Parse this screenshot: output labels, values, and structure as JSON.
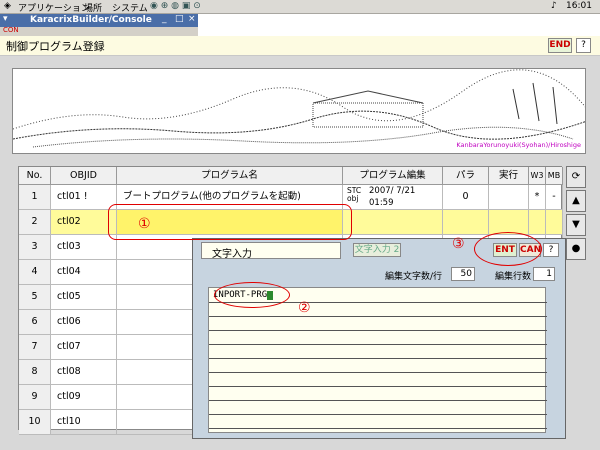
{
  "system_bar": {
    "apps": "アプリケーション",
    "places": "場所",
    "system": "システム",
    "clock": "16:01"
  },
  "window": {
    "title": "KaracrixBuilder/Console",
    "tag": "CON"
  },
  "page": {
    "title": "制御プログラム登録",
    "end_label": "END",
    "help_label": "?"
  },
  "banner": {
    "credit": "KanbaraYorunoyuki(Syohan)/Hiroshige"
  },
  "table": {
    "headers": [
      "No.",
      "OBJID",
      "プログラム名",
      "プログラム編集",
      "パラ",
      "実行",
      "W3",
      "MB"
    ],
    "rows": [
      {
        "no": "1",
        "objid": "ctl01 !",
        "name": "ブートプログラム(他のプログラムを起動)",
        "edit": "STC\nobj",
        "date": "2007/ 7/21 01:59",
        "para": "0",
        "w3": "*",
        "mb": "-"
      },
      {
        "no": "2",
        "objid": "ctl02",
        "name": "",
        "edit": "",
        "date": "",
        "para": "",
        "w3": "",
        "mb": ""
      },
      {
        "no": "3",
        "objid": "ctl03"
      },
      {
        "no": "4",
        "objid": "ctl04"
      },
      {
        "no": "5",
        "objid": "ctl05"
      },
      {
        "no": "6",
        "objid": "ctl06"
      },
      {
        "no": "7",
        "objid": "ctl07"
      },
      {
        "no": "8",
        "objid": "ctl08"
      },
      {
        "no": "9",
        "objid": "ctl09"
      },
      {
        "no": "10",
        "objid": "ctl10"
      }
    ]
  },
  "popup": {
    "title": "文字入力",
    "tab_label": "文字入力 2",
    "ent_label": "ENT",
    "can_label": "CAN",
    "help_label": "?",
    "chars_label": "編集文字数/行",
    "chars_value": "50",
    "lines_label": "編集行数",
    "lines_value": "1",
    "text_value": "INPORT-PRG"
  },
  "annotations": {
    "one": "①",
    "two": "②",
    "three": "③"
  }
}
